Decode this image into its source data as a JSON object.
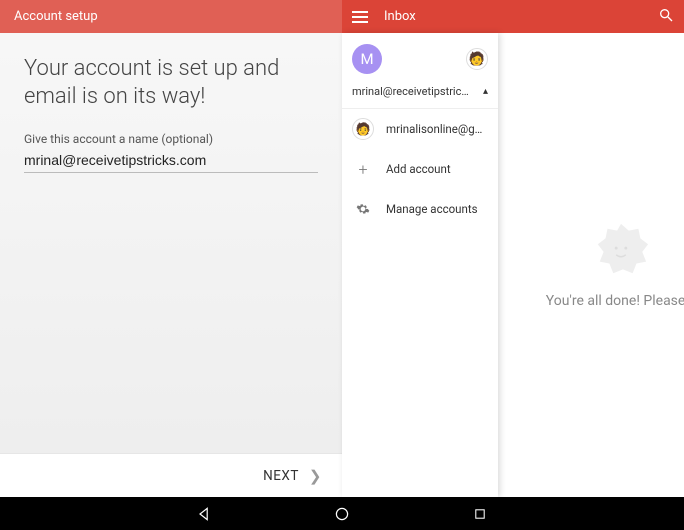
{
  "left": {
    "header_title": "Account setup",
    "headline_line1": "Your account is set up and",
    "headline_line2": "email is on its way!",
    "name_hint": "Give this account a name (optional)",
    "name_value": "mrinal@receivetipstricks.com",
    "next_label": "NEXT"
  },
  "right": {
    "header_title": "Inbox",
    "current_avatar_letter": "M",
    "current_email": "mrinal@receivetipstricks...",
    "other_account": "mrinalisonline@gmail....",
    "add_account": "Add account",
    "manage_accounts": "Manage accounts",
    "empty_text": "You're all done! Please e"
  }
}
